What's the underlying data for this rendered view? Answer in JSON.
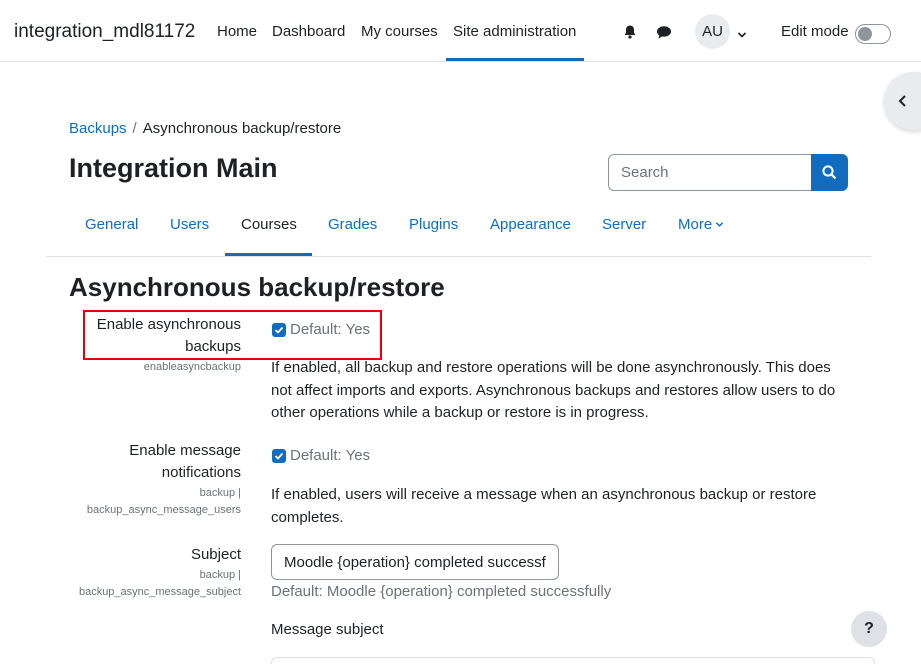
{
  "navbar": {
    "brand": "integration_mdl81172",
    "links": [
      "Home",
      "Dashboard",
      "My courses",
      "Site administration"
    ],
    "avatar_initials": "AU",
    "edit_mode_label": "Edit mode"
  },
  "breadcrumb": {
    "parent": "Backups",
    "separator": "/",
    "current": "Asynchronous backup/restore"
  },
  "page": {
    "title": "Integration Main",
    "search_placeholder": "Search"
  },
  "tabs": {
    "items": [
      "General",
      "Users",
      "Courses",
      "Grades",
      "Plugins",
      "Appearance",
      "Server",
      "More"
    ],
    "active": "Courses"
  },
  "section": {
    "heading": "Asynchronous backup/restore"
  },
  "settings": {
    "async": {
      "label_line1": "Enable asynchronous",
      "label_line2": "backups",
      "key": "enableasyncbackup",
      "default": "Default: Yes",
      "checked": true,
      "description": "If enabled, all backup and restore operations will be done asynchronously. This does not affect imports and exports. Asynchronous backups and restores allow users to do other operations while a backup or restore is in progress."
    },
    "notify": {
      "label_line1": "Enable message",
      "label_line2": "notifications",
      "key_line1": "backup |",
      "key_line2": "backup_async_message_users",
      "default": "Default: Yes",
      "checked": true,
      "description": "If enabled, users will receive a message when an asynchronous backup or restore completes."
    },
    "subject": {
      "label": "Subject",
      "key_line1": "backup |",
      "key_line2": "backup_async_message_subject",
      "value": "Moodle {operation} completed successfully",
      "default": "Default: Moodle {operation} completed successfully",
      "description": "Message subject"
    }
  },
  "help": {
    "label": "?"
  },
  "colors": {
    "primary": "#0f6cbf",
    "highlight": "#e60000",
    "muted": "#6a737b"
  }
}
